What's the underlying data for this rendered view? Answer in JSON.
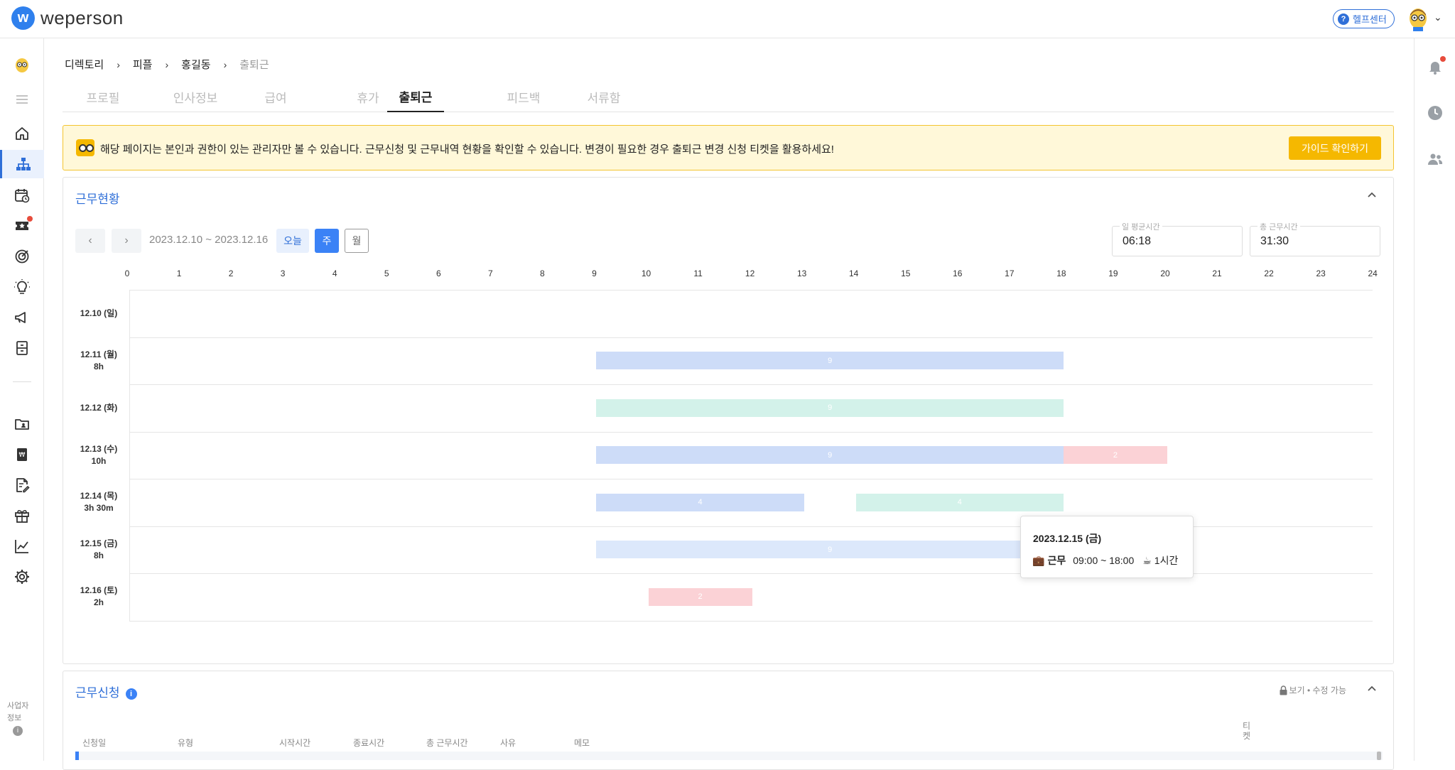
{
  "app": {
    "logo_mark": "w",
    "logo_text": "weperson",
    "help_label": "헬프센터",
    "help_icon": "?"
  },
  "sidebar": {
    "business_info": "사업자\n정보",
    "info_icon": "i"
  },
  "breadcrumb": [
    "디렉토리",
    "피플",
    "홍길동",
    "출퇴근"
  ],
  "breadcrumb_sep": "›",
  "tabs": [
    "프로필",
    "인사정보",
    "급여",
    "휴가",
    "출퇴근",
    "피드백",
    "서류함"
  ],
  "active_tab": 4,
  "notice": {
    "text": "해당 페이지는 본인과 권한이 있는 관리자만 볼 수 있습니다. 근무신청 및 근무내역 현황을 확인할 수 있습니다. 변경이 필요한 경우 출퇴근 변경 신청 티켓을 활용하세요!",
    "button": "가이드 확인하기"
  },
  "work_status": {
    "title": "근무현황",
    "prev": "‹",
    "next": "›",
    "range": "2023.12.10 ~ 2023.12.16",
    "btn_today": "오늘",
    "btn_week": "주",
    "btn_month": "월",
    "avg_label": "일 평균시간",
    "avg_value": "06:18",
    "total_label": "총 근무시간",
    "total_value": "31:30"
  },
  "hours": [
    "0",
    "1",
    "2",
    "3",
    "4",
    "5",
    "6",
    "7",
    "8",
    "9",
    "10",
    "11",
    "12",
    "13",
    "14",
    "15",
    "16",
    "17",
    "18",
    "19",
    "20",
    "21",
    "22",
    "23",
    "24"
  ],
  "days": [
    {
      "date": "12.10 (일)",
      "hours": ""
    },
    {
      "date": "12.11 (월)",
      "hours": "8h"
    },
    {
      "date": "12.12 (화)",
      "hours": ""
    },
    {
      "date": "12.13 (수)",
      "hours": "10h"
    },
    {
      "date": "12.14 (목)",
      "hours": "3h 30m"
    },
    {
      "date": "12.15 (금)",
      "hours": "8h"
    },
    {
      "date": "12.16 (토)",
      "hours": "2h"
    }
  ],
  "bars": [
    {
      "day": 1,
      "start": 9,
      "end": 18,
      "label": "9",
      "color": "#cddcf8"
    },
    {
      "day": 2,
      "start": 9,
      "end": 18,
      "label": "9",
      "color": "#d3f2ea"
    },
    {
      "day": 3,
      "start": 9,
      "end": 18,
      "label": "9",
      "color": "#cddcf8"
    },
    {
      "day": 3,
      "start": 18,
      "end": 20,
      "label": "2",
      "color": "#fbd2d6"
    },
    {
      "day": 4,
      "start": 9,
      "end": 13,
      "label": "4",
      "color": "#cddcf8"
    },
    {
      "day": 4,
      "start": 14,
      "end": 18,
      "label": "4",
      "color": "#d3f2ea"
    },
    {
      "day": 5,
      "start": 9,
      "end": 18,
      "label": "9",
      "color": "#dce8fb"
    },
    {
      "day": 6,
      "start": 10,
      "end": 12,
      "label": "2",
      "color": "#fbd2d6"
    }
  ],
  "tooltip": {
    "date": "2023.12.15 (금)",
    "type_icon": "💼",
    "type": "근무",
    "time": "09:00 ~ 18:00",
    "break_icon": "☕",
    "break": "1시간"
  },
  "work_request": {
    "title": "근무신청",
    "info_icon": "i",
    "permission": "보기 • 수정 가능",
    "columns": [
      "신청일",
      "유형",
      "시작시간",
      "종료시간",
      "총 근무시간",
      "사유",
      "메모",
      "티\n켓"
    ]
  }
}
